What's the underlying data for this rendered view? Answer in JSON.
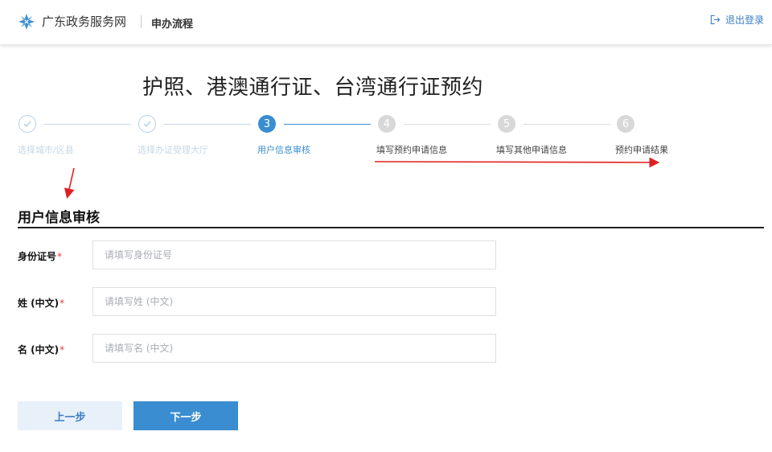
{
  "header": {
    "site_name": "广东政务服务网",
    "process_title": "申办流程",
    "logout_label": "退出登录"
  },
  "page": {
    "title": "护照、港澳通行证、台湾通行证预约"
  },
  "steps": [
    {
      "number": "",
      "label": "选择城市/区县",
      "status": "done"
    },
    {
      "number": "",
      "label": "选择办证受理大厅",
      "status": "done"
    },
    {
      "number": "3",
      "label": "用户信息审核",
      "status": "active"
    },
    {
      "number": "4",
      "label": "填写预约申请信息",
      "status": "todo"
    },
    {
      "number": "5",
      "label": "填写其他申请信息",
      "status": "todo"
    },
    {
      "number": "6",
      "label": "预约申请结果",
      "status": "todo"
    }
  ],
  "section": {
    "title": "用户信息审核"
  },
  "form": {
    "id_number": {
      "label": "身份证号",
      "required_mark": "*",
      "placeholder": "请填写身份证号",
      "value": ""
    },
    "surname": {
      "label": "姓 (中文)",
      "required_mark": "*",
      "placeholder": "请填写姓 (中文)",
      "value": ""
    },
    "given_name": {
      "label": "名 (中文)",
      "required_mark": "*",
      "placeholder": "请填写名 (中文)",
      "value": ""
    }
  },
  "buttons": {
    "prev_label": "上一步",
    "next_label": "下一步"
  },
  "colors": {
    "accent": "#3a8dd0",
    "annotation": "#e02020"
  },
  "icons": {
    "logo": "guangdong-flower-icon",
    "logout": "logout-icon",
    "done_step": "check-icon"
  }
}
